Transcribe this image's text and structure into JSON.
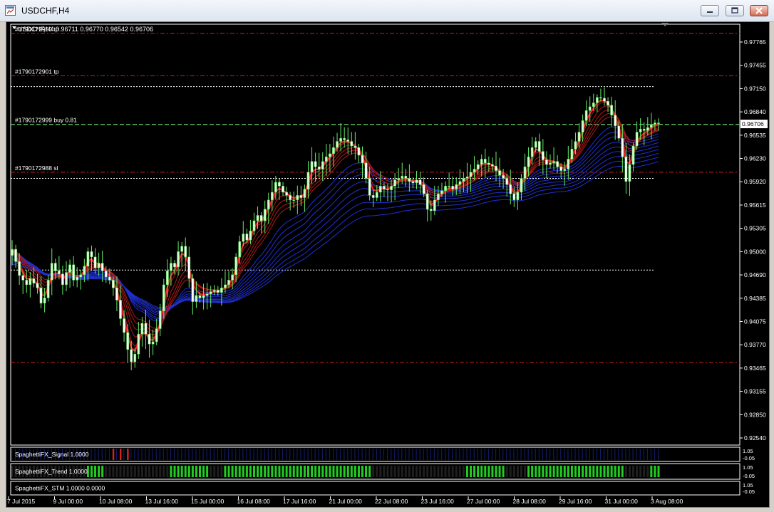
{
  "window": {
    "title": "USDCHF,H4"
  },
  "main_chart": {
    "header": "USDCHF,H4  0.96711 0.96770 0.96542 0.96706",
    "current_price": "0.96706",
    "price_levels": [
      "0.97765",
      "0.97455",
      "0.97150",
      "0.96840",
      "0.96535",
      "0.96230",
      "0.95920",
      "0.95615",
      "0.95305",
      "0.95000",
      "0.94690",
      "0.94385",
      "0.94075",
      "0.93770",
      "0.93465",
      "0.93155",
      "0.92850",
      "0.92540"
    ],
    "order_labels": [
      {
        "text": "#1790172950 tp",
        "price": 0.9788
      },
      {
        "text": "#1790172901 tp",
        "price": 0.9733
      },
      {
        "text": "#1790172999 buy 0.81",
        "price": 0.967
      },
      {
        "text": "#1790172988 sl",
        "price": 0.9608
      }
    ],
    "lines": {
      "red_dash": [
        0.9788,
        0.9733,
        0.9608,
        0.9361
      ],
      "white_dot": [
        0.9719,
        0.96,
        0.9481
      ],
      "green_dash": [
        0.967
      ]
    },
    "colors": {
      "bull": "#ccffcc",
      "bear": "#ffffff",
      "ma_red": "#d02020",
      "ma_blue": "#2030d0",
      "trend": "#22cc22",
      "signal": "#dd2020"
    }
  },
  "x_axis": {
    "labels": [
      "7 Jul 2015",
      "9 Jul 00:00",
      "10 Jul 08:00",
      "13 Jul 16:00",
      "15 Jul 00:00",
      "16 Jul 08:00",
      "17 Jul 16:00",
      "21 Jul 00:00",
      "22 Jul 08:00",
      "23 Jul 16:00",
      "27 Jul 00:00",
      "28 Jul 08:00",
      "29 Jul 16:00",
      "31 Jul 00:00",
      "3 Aug 08:00"
    ]
  },
  "indicators": [
    {
      "name": "SpaghettiFX_Signal 1.0000",
      "scale_top": "1.05",
      "scale_bottom": "-0.05"
    },
    {
      "name": "SpaghettiFX_Trend 1.0000",
      "scale_top": "1.05",
      "scale_bottom": "-0.05"
    },
    {
      "name": "SpaghettiFX_STM 1.0000 0.0000",
      "scale_top": "1.05",
      "scale_bottom": "-0.05"
    }
  ],
  "chart_data": {
    "type": "candlestick",
    "symbol": "USDCHF",
    "timeframe": "H4",
    "ylim": [
      0.9254,
      0.98
    ],
    "closes": [
      0.9508,
      0.9492,
      0.9474,
      0.9468,
      0.9462,
      0.947,
      0.9464,
      0.9458,
      0.9438,
      0.9445,
      0.9468,
      0.949,
      0.948,
      0.9476,
      0.9462,
      0.9478,
      0.9488,
      0.9468,
      0.9472,
      0.9475,
      0.9486,
      0.9505,
      0.9498,
      0.9484,
      0.949,
      0.948,
      0.9472,
      0.9468,
      0.9458,
      0.9442,
      0.9418,
      0.94,
      0.9378,
      0.9362,
      0.9372,
      0.9398,
      0.9412,
      0.9398,
      0.9385,
      0.9388,
      0.9405,
      0.9428,
      0.9462,
      0.948,
      0.949,
      0.9485,
      0.9505,
      0.9512,
      0.9498,
      0.947,
      0.944,
      0.9448,
      0.9445,
      0.9448,
      0.945,
      0.9453,
      0.9455,
      0.9452,
      0.9458,
      0.9462,
      0.9468,
      0.9475,
      0.9498,
      0.9518,
      0.9528,
      0.952,
      0.9532,
      0.9545,
      0.9552,
      0.9545,
      0.956,
      0.9572,
      0.9582,
      0.9595,
      0.959,
      0.9582,
      0.9578,
      0.9572,
      0.9572,
      0.9578,
      0.9575,
      0.9586,
      0.9608,
      0.9622,
      0.9615,
      0.9612,
      0.9622,
      0.9628,
      0.9632,
      0.964,
      0.9648,
      0.9652,
      0.965,
      0.9648,
      0.9642,
      0.964,
      0.963,
      0.962,
      0.96,
      0.9578,
      0.9575,
      0.9582,
      0.959,
      0.9586,
      0.9585,
      0.959,
      0.9598,
      0.96,
      0.9603,
      0.96,
      0.9596,
      0.9594,
      0.9598,
      0.9592,
      0.958,
      0.956,
      0.9558,
      0.9572,
      0.958,
      0.9584,
      0.959,
      0.959,
      0.9586,
      0.9592,
      0.9596,
      0.96,
      0.9602,
      0.9608,
      0.9612,
      0.9618,
      0.9625,
      0.962,
      0.9618,
      0.9616,
      0.961,
      0.9604,
      0.96,
      0.9592,
      0.958,
      0.9572,
      0.9582,
      0.96,
      0.9615,
      0.9628,
      0.964,
      0.9648,
      0.9635,
      0.9624,
      0.9618,
      0.962,
      0.9622,
      0.9615,
      0.961,
      0.9612,
      0.9625,
      0.9638,
      0.9648,
      0.966,
      0.9675,
      0.9688,
      0.9693,
      0.9698,
      0.9705,
      0.9704,
      0.97,
      0.9695,
      0.9682,
      0.9668,
      0.9652,
      0.9628,
      0.9596,
      0.9618,
      0.9642,
      0.966,
      0.9664,
      0.9662,
      0.9666,
      0.967,
      0.9672,
      0.9671
    ]
  }
}
